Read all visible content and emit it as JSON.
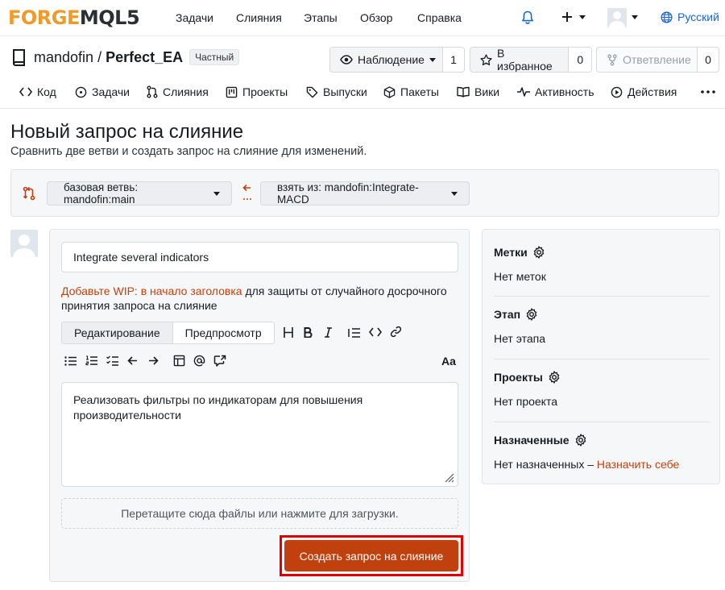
{
  "nav": {
    "logo_forge": "FORGE",
    "logo_mql": "MQL5",
    "links": [
      "Задачи",
      "Слияния",
      "Этапы",
      "Обзор",
      "Справка"
    ],
    "language": "Русский",
    "icons": [
      "bell-icon",
      "plus-icon",
      "chevron-down-icon",
      "avatar",
      "globe-icon"
    ]
  },
  "repo": {
    "owner": "mandofin",
    "name": "Perfect_EA",
    "badge": "Частный",
    "watch_label": "Наблюдение",
    "watch_count": "1",
    "star_label": "В избранное",
    "star_count": "0",
    "fork_label": "Ответвление",
    "fork_count": "0"
  },
  "tabs": [
    {
      "label": "Код",
      "icon": "code-icon"
    },
    {
      "label": "Задачи",
      "icon": "issue-icon"
    },
    {
      "label": "Слияния",
      "icon": "pull-request-icon"
    },
    {
      "label": "Проекты",
      "icon": "project-icon"
    },
    {
      "label": "Выпуски",
      "icon": "tag-icon"
    },
    {
      "label": "Пакеты",
      "icon": "package-icon"
    },
    {
      "label": "Вики",
      "icon": "book-icon"
    },
    {
      "label": "Активность",
      "icon": "pulse-icon"
    },
    {
      "label": "Действия",
      "icon": "play-icon"
    }
  ],
  "page": {
    "title": "Новый запрос на слияние",
    "subtitle": "Сравнить две ветви и создать запрос на слияние для изменений."
  },
  "compare": {
    "base": "базовая ветвь: mandofin:main",
    "head": "взять из: mandofin:Integrate-MACD"
  },
  "form": {
    "title_value": "Integrate several indicators",
    "wip_link": "Добавьте WIP: в начало заголовка",
    "wip_rest": " для защиты от случайного досрочного принятия запроса на слияние",
    "tab_edit": "Редактирование",
    "tab_preview": "Предпросмотр",
    "body_value": "Реализовать фильтры по индикаторам для повышения производительности",
    "dropzone": "Перетащите сюда файлы или нажмите для загрузки.",
    "submit": "Создать запрос на слияние"
  },
  "sidebar": {
    "labels_head": "Метки",
    "labels_val": "Нет меток",
    "milestone_head": "Этап",
    "milestone_val": "Нет этапа",
    "projects_head": "Проекты",
    "projects_val": "Нет проекта",
    "assignees_head": "Назначенные",
    "assignees_val": "Нет назначенных – ",
    "assign_self": "Назначить себе"
  }
}
